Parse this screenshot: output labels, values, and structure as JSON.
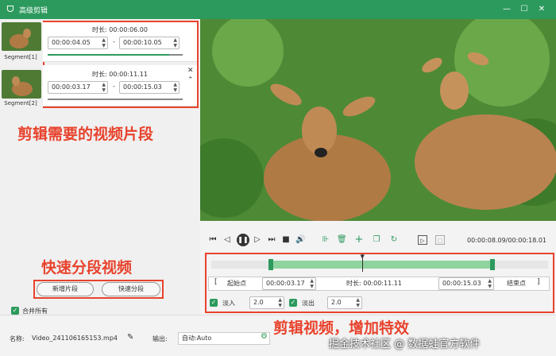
{
  "window": {
    "title": "高级剪辑",
    "minimize": "—",
    "maximize": "☐",
    "close": "✕",
    "logo": "ᗜ"
  },
  "segments": [
    {
      "label": "Segment[1]",
      "duration_label": "时长:",
      "duration": "00:00:06.00",
      "start": "00:00:04.05",
      "end": "00:00:10.05",
      "separator": "-",
      "progress": 0.9
    },
    {
      "label": "Segment[2]",
      "duration_label": "时长:",
      "duration": "00:00:11.11",
      "start": "00:00:03.17",
      "end": "00:00:15.03",
      "separator": "-",
      "progress": 0.9
    }
  ],
  "annotations": {
    "segments": "剪辑需要的视频片段",
    "split": "快速分段视频",
    "effects": "剪辑视频，增加特效"
  },
  "buttons": {
    "add_segment": "新增片段",
    "quick_split": "快速分段"
  },
  "merge_all": {
    "label": "合并所有",
    "checked": true
  },
  "player": {
    "time": "00:00:08.09/00:00:18.01"
  },
  "trim": {
    "start_bracket": "[",
    "start_label": "起始点",
    "start_value": "00:00:03.17",
    "duration_label": "时长:",
    "duration_value": "00:00:11.11",
    "end_value": "00:00:15.03",
    "end_label": "结束点",
    "end_bracket": "]",
    "fade_in_label": "淡入",
    "fade_in_value": "2.0",
    "fade_out_label": "淡出",
    "fade_out_value": "2.0"
  },
  "output": {
    "name_label": "名称:",
    "name_value": "Video_241106165153.mp4",
    "out_label": "输出:",
    "out_value": "自动:Auto"
  },
  "watermark": "掘金技术社区 @ 数据蛙官方软件",
  "colors": {
    "accent": "#2d9a5d",
    "annotation": "#e8432d"
  }
}
